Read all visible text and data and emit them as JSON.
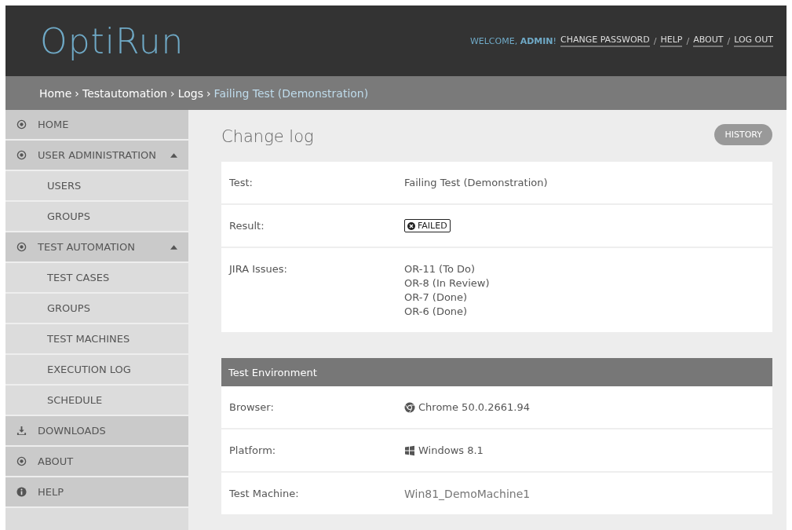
{
  "header": {
    "logo": "OptiRun",
    "welcome": "WELCOME, **ADMIN**!",
    "separator": "/",
    "links": [
      "CHANGE PASSWORD",
      "HELP",
      "ABOUT",
      "LOG OUT"
    ]
  },
  "breadcrumb": {
    "separator": "›",
    "items": [
      {
        "label": "Home",
        "current": false
      },
      {
        "label": "Testautomation",
        "current": false
      },
      {
        "label": "Logs",
        "current": false
      },
      {
        "label": "Failing Test (Demonstration)",
        "current": true
      }
    ]
  },
  "sidebar": {
    "items": [
      {
        "kind": "target",
        "label": "HOME"
      },
      {
        "kind": "target",
        "label": "USER ADMINISTRATION",
        "expanded": true
      },
      {
        "kind": "sub",
        "label": "USERS"
      },
      {
        "kind": "sub",
        "label": "GROUPS"
      },
      {
        "kind": "target",
        "label": "TEST AUTOMATION",
        "expanded": true
      },
      {
        "kind": "sub",
        "label": "TEST CASES"
      },
      {
        "kind": "sub",
        "label": "GROUPS"
      },
      {
        "kind": "sub",
        "label": "TEST MACHINES"
      },
      {
        "kind": "sub",
        "label": "EXECUTION LOG"
      },
      {
        "kind": "sub",
        "label": "SCHEDULE"
      },
      {
        "kind": "download",
        "label": "DOWNLOADS"
      },
      {
        "kind": "target",
        "label": "ABOUT"
      },
      {
        "kind": "info",
        "label": "HELP"
      }
    ]
  },
  "content": {
    "title": "Change log",
    "history_button": "HISTORY",
    "details": [
      {
        "kind": "text",
        "label": "Test:",
        "value": "Failing Test (Demonstration)"
      },
      {
        "kind": "badge",
        "label": "Result:",
        "value": "FAILED"
      },
      {
        "kind": "list",
        "label": "JIRA Issues:",
        "values": [
          "OR-11 (To Do)",
          "OR-8 (In Review)",
          "OR-7 (Done)",
          "OR-6 (Done)"
        ]
      }
    ],
    "environment": {
      "title": "Test Environment",
      "rows": [
        {
          "kind": "browser",
          "label": "Browser:",
          "value": "Chrome 50.0.2661.94"
        },
        {
          "kind": "platform",
          "label": "Platform:",
          "value": "Windows 8.1"
        },
        {
          "kind": "muted",
          "label": "Test Machine:",
          "value": "Win81_DemoMachine1"
        }
      ]
    }
  }
}
